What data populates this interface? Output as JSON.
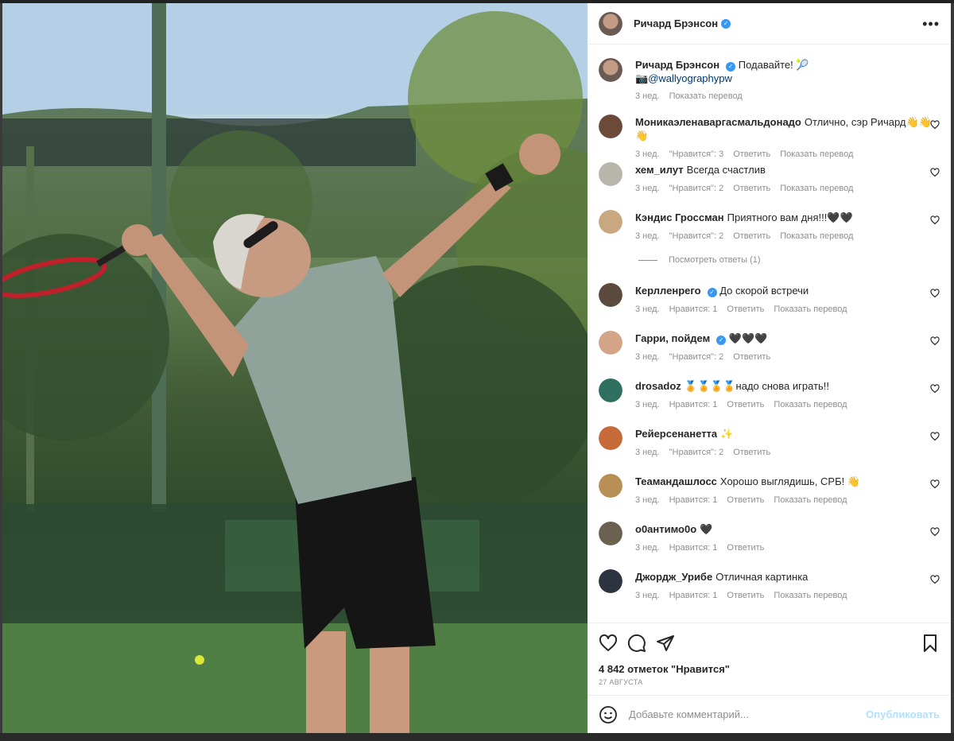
{
  "post": {
    "author": "Ричард Брэнсон",
    "caption_text": "Подавайте! 🎾",
    "caption_line2_prefix": "📷",
    "caption_mention": "@wallyographypw",
    "caption_age": "3 нед.",
    "show_translation": "Показать перевод"
  },
  "comments": [
    {
      "user": "Моникаэленаваргасмальдонадо",
      "text": "Отлично, сэр Ричард👋👋👋",
      "age": "3 нед.",
      "likes": "\"Нравится\": 3",
      "reply": "Ответить",
      "translate": "Показать перевод",
      "verified": false,
      "color": "#6b4a3a"
    },
    {
      "user": "хем_илут",
      "text": "Всегда счастлив",
      "age": "3 нед.",
      "likes": "\"Нравится\": 2",
      "reply": "Ответить",
      "translate": "Показать перевод",
      "verified": false,
      "color": "#b8b6aa"
    },
    {
      "user": "Кэндис Гроссман",
      "text": "Приятного вам дня!!!🖤🖤",
      "age": "3 нед.",
      "likes": "\"Нравится\": 2",
      "reply": "Ответить",
      "translate": "Показать перевод",
      "verified": false,
      "color": "#c9a780",
      "replies": "Посмотреть ответы (1)"
    },
    {
      "user": "Керлленрего",
      "text": "До скорой встречи",
      "age": "3 нед.",
      "likes": "Нравится: 1",
      "reply": "Ответить",
      "translate": "Показать перевод",
      "verified": true,
      "color": "#5c4a3e"
    },
    {
      "user": "Гарри, пойдем",
      "text": "🖤🖤🖤",
      "age": "3 нед.",
      "likes": "\"Нравится\": 2",
      "reply": "Ответить",
      "translate": "",
      "verified": true,
      "color": "#d3a488"
    },
    {
      "user": "drosadoz",
      "text": "🏅🏅🏅🏅надо снова играть!!",
      "age": "3 нед.",
      "likes": "Нравится: 1",
      "reply": "Ответить",
      "translate": "Показать перевод",
      "verified": false,
      "color": "#2f6f5f"
    },
    {
      "user": "Рейерсенанетта",
      "text": "✨",
      "age": "3 нед.",
      "likes": "\"Нравится\": 2",
      "reply": "Ответить",
      "translate": "",
      "verified": false,
      "color": "#c76a3a"
    },
    {
      "user": "Теамандашлосс",
      "text": "Хорошо выглядишь, СРБ! 👋",
      "age": "3 нед.",
      "likes": "Нравится: 1",
      "reply": "Ответить",
      "translate": "Показать перевод",
      "verified": false,
      "color": "#b89056"
    },
    {
      "user": "о0антимо0о",
      "text": "🖤",
      "age": "3 нед.",
      "likes": "Нравится: 1",
      "reply": "Ответить",
      "translate": "",
      "verified": false,
      "color": "#6a6150"
    },
    {
      "user": "Джордж_Урибе",
      "text": "Отличная картинка",
      "age": "3 нед.",
      "likes": "Нравится: 1",
      "reply": "Ответить",
      "translate": "Показать перевод",
      "verified": false,
      "color": "#2e3340"
    }
  ],
  "footer": {
    "likes_count": "4 842 отметок \"Нравится\"",
    "date": "27 АВГУСТА",
    "comment_placeholder": "Добавьте комментарий...",
    "publish_label": "Опубликовать"
  },
  "icons": {
    "header_more": "more-horizontal-icon",
    "like": "heart-icon",
    "comment": "comment-bubble-icon",
    "share": "paper-plane-icon",
    "save": "bookmark-icon",
    "emoji": "emoji-icon"
  },
  "colors": {
    "verified": "#3897f0",
    "text": "#262626",
    "muted": "#8e8e8e",
    "publish_disabled": "#b2dffc"
  }
}
